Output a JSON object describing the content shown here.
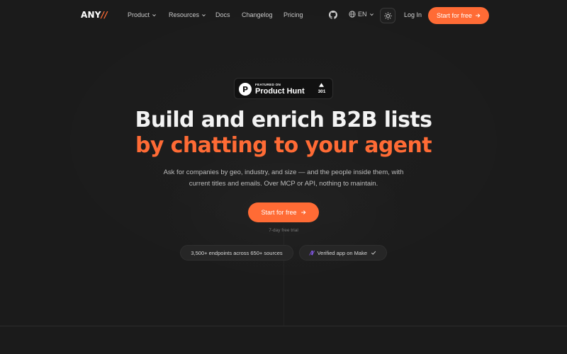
{
  "brand": {
    "logo_main": "ANY",
    "logo_slashes": "//",
    "accent_color": "#ff6b35"
  },
  "nav": {
    "links": [
      {
        "label": "Product",
        "has_dropdown": true
      },
      {
        "label": "Resources",
        "has_dropdown": true
      },
      {
        "label": "Docs",
        "has_dropdown": false
      },
      {
        "label": "Changelog",
        "has_dropdown": false
      },
      {
        "label": "Pricing",
        "has_dropdown": false
      }
    ],
    "github_icon": "github-icon",
    "language": "EN",
    "theme_icon": "sun-icon",
    "login_label": "Log In",
    "cta_label": "Start for free"
  },
  "product_hunt": {
    "featured_label": "FEATURED ON",
    "name": "Product Hunt",
    "logo_letter": "P",
    "upvotes": "301"
  },
  "hero": {
    "headline_line1": "Build and enrich B2B lists",
    "headline_line2": "by chatting to your agent",
    "subtitle_line1": "Ask for companies by geo, industry, and size — and the people inside them, with",
    "subtitle_line2": "current titles and emails. Over MCP or API, nothing to maintain.",
    "cta_label": "Start for free",
    "trial_note": "7-day free trial"
  },
  "badges": {
    "endpoints": "3,500+ endpoints across 650+ sources",
    "make": "Verified app on Make",
    "make_icon": "make-logo-icon"
  }
}
